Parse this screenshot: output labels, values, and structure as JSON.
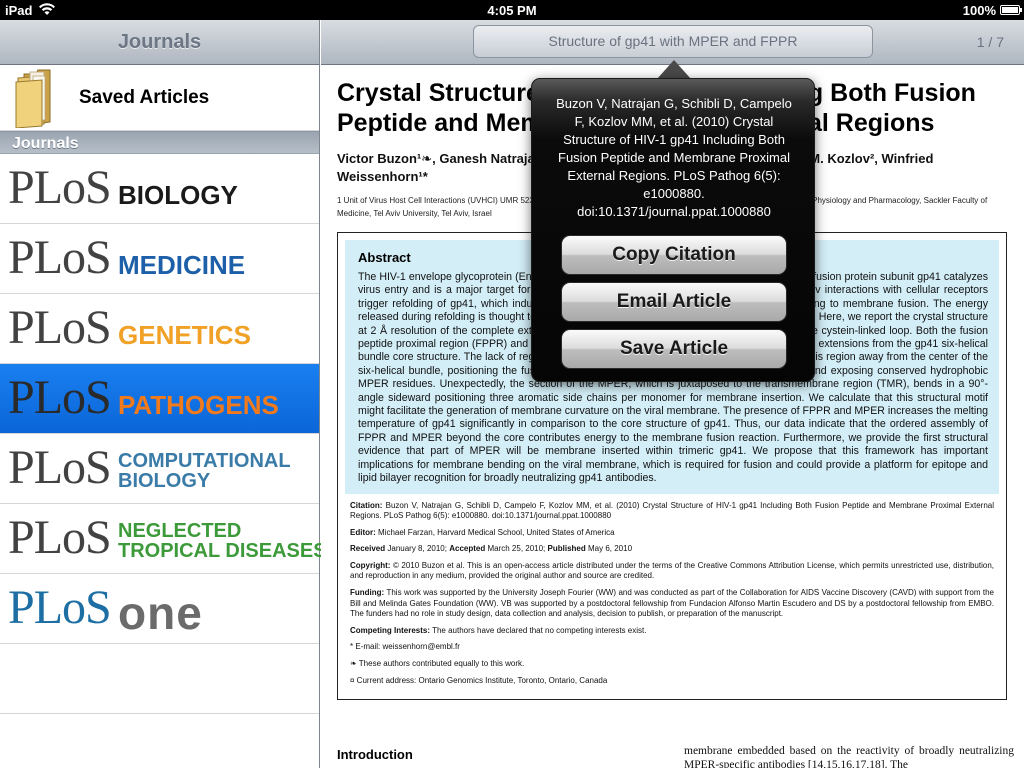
{
  "status_bar": {
    "carrier": "iPad",
    "time": "4:05 PM",
    "battery": "100%"
  },
  "sidebar": {
    "title": "Journals",
    "saved_articles": "Saved Articles",
    "section_header": "Journals",
    "journals": [
      {
        "mark": "PLoS",
        "name_lines": [
          "BIOLOGY"
        ],
        "color": "#1a1a1a"
      },
      {
        "mark": "PLoS",
        "name_lines": [
          "MEDICINE"
        ],
        "color": "#1d5fa8"
      },
      {
        "mark": "PLoS",
        "name_lines": [
          "GENETICS"
        ],
        "color": "#f0a126"
      },
      {
        "mark": "PLoS",
        "name_lines": [
          "PATHOGENS"
        ],
        "color": "#f07a1c",
        "selected": true
      },
      {
        "mark": "PLoS",
        "name_lines": [
          "COMPUTATIONAL",
          "BIOLOGY"
        ],
        "color": "#3a7ba8"
      },
      {
        "mark": "PLoS",
        "name_lines": [
          "NEGLECTED",
          "TROPICAL DISEASES"
        ],
        "color": "#3d9a3a"
      },
      {
        "mark": "PLoS",
        "name_lines": [
          "one"
        ],
        "color": "#6b6b6b"
      }
    ]
  },
  "main": {
    "nav_title": "Structure of gp41 with MPER and FPPR",
    "page_counter": "1 / 7",
    "article": {
      "title": "Crystal Structure of HIV-1 gp41 Including Both Fusion Peptide and Membrane Proximal External Regions",
      "authors": "Victor Buzon¹❧, Ganesh Natrajan¹❧, David Schibli¹, Felix Campelo², Michael M. Kozlov², Winfried Weissenhorn¹*",
      "affiliation": "1 Unit of Virus Host Cell Interactions (UVHCI) UMR 5233 Université Joseph Fourier-EMBL-CNRS, Grenoble, France, 2 Department of Physiology and Pharmacology, Sackler Faculty of Medicine, Tel Aviv University, Tel Aviv, Israel",
      "abstract_heading": "Abstract",
      "abstract_text": "The HIV-1 envelope glycoprotein (Env) composed of the receptor binding domain gp120 and the fusion protein subunit gp41 catalyzes virus entry and is a major target for therapeutic intervention and for neutralizing antibodies. Env interactions with cellular receptors trigger refolding of gp41, which induces close apposition of viral and cellular membranes leading to membrane fusion. The energy released during refolding is thought to overcome the kinetic barrier and drives the fusion reaction. Here, we report the crystal structure at 2 Å resolution of the complete extracellular domain of gp41 lacking the fusion peptide and the cystein-linked loop. Both the fusion peptide proximal region (FPPR) and the membrane proximal external region (MPER) form helical extensions from the gp41 six-helical bundle core structure. The lack of regular coiled-coil interactions within FPPR and MPER splay this region away from the center of the six-helical bundle, positioning the fusion peptide towards the outside of the six-helical bundle and exposing conserved hydrophobic MPER residues. Unexpectedly, the section of the MPER, which is juxtaposed to the transmembrane region (TMR), bends in a 90°-angle sideward positioning three aromatic side chains per monomer for membrane insertion. We calculate that this structural motif might facilitate the generation of membrane curvature on the viral membrane. The presence of FPPR and MPER increases the melting temperature of gp41 significantly in comparison to the core structure of gp41. Thus, our data indicate that the ordered assembly of FPPR and MPER beyond the core contributes energy to the membrane fusion reaction. Furthermore, we provide the first structural evidence that part of MPER will be membrane inserted within trimeric gp41. We propose that this framework has important implications for membrane bending on the viral membrane, which is required for fusion and could provide a platform for epitope and lipid bilayer recognition for broadly neutralizing gp41 antibodies.",
      "citation_label": "Citation:",
      "citation_text": "Buzon V, Natrajan G, Schibli D, Campelo F, Kozlov MM, et al. (2010) Crystal Structure of HIV-1 gp41 Including Both Fusion Peptide and Membrane Proximal External Regions. PLoS Pathog 6(5): e1000880. doi:10.1371/journal.ppat.1000880",
      "editor_label": "Editor:",
      "editor_text": "Michael Farzan, Harvard Medical School, United States of America",
      "received_label": "Received",
      "received_text": "January 8, 2010;",
      "accepted_label": "Accepted",
      "accepted_text": "March 25, 2010;",
      "published_label": "Published",
      "published_text": "May 6, 2010",
      "copyright_label": "Copyright:",
      "copyright_text": "© 2010 Buzon et al. This is an open-access article distributed under the terms of the Creative Commons Attribution License, which permits unrestricted use, distribution, and reproduction in any medium, provided the original author and source are credited.",
      "funding_label": "Funding:",
      "funding_text": "This work was supported by the University Joseph Fourier (WW) and was conducted as part of the Collaboration for AIDS Vaccine Discovery (CAVD) with support from the Bill and Melinda Gates Foundation (WW). VB was supported by a postdoctoral fellowship from Fundacion Alfonso Martin Escudero and DS by a postdoctoral fellowship from EMBO. The funders had no role in study design, data collection and analysis, decision to publish, or preparation of the manuscript.",
      "competing_label": "Competing Interests:",
      "competing_text": "The authors have declared that no competing interests exist.",
      "email_note": "* E-mail: weissenhorn@embl.fr",
      "equal_note": "❧ These authors contributed equally to this work.",
      "address_note": "¤ Current address: Ontario Genomics Institute, Toronto, Ontario, Canada",
      "intro_heading": "Introduction",
      "intro_text": "membrane embedded based on the reactivity of broadly neutralizing MPER-specific antibodies [14,15,16,17,18]. The"
    }
  },
  "popover": {
    "citation": "Buzon V, Natrajan G, Schibli D, Campelo F, Kozlov MM, et al. (2010) Crystal Structure of HIV-1 gp41 Including Both Fusion Peptide and Membrane Proximal External Regions. PLoS Pathog 6(5): e1000880. doi:10.1371/journal.ppat.1000880",
    "copy_citation": "Copy Citation",
    "email_article": "Email Article",
    "save_article": "Save Article"
  }
}
